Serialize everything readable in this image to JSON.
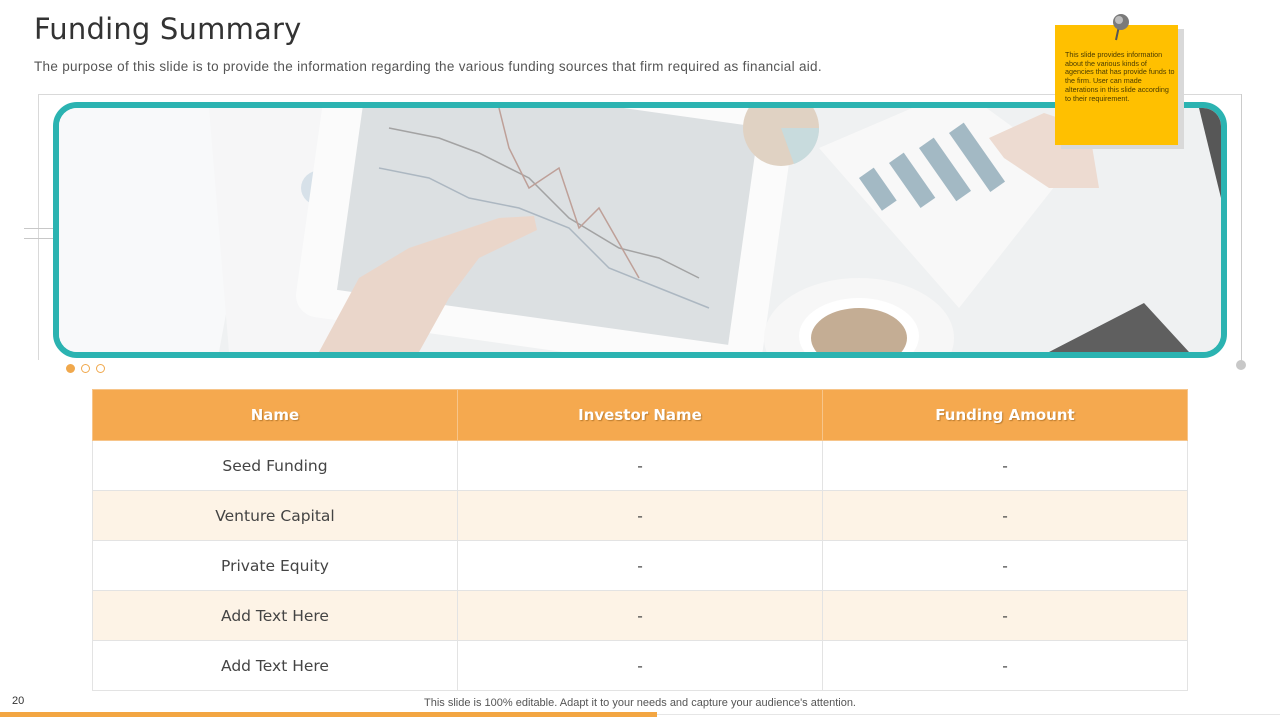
{
  "slide": {
    "title": "Funding Summary",
    "subtitle": "The purpose of this slide is to provide the information regarding the various funding sources that firm required as financial aid."
  },
  "note": {
    "text": "This slide provides information about the various kinds of agencies that has provide funds to the firm. User can made alterations in this slide according to their requirement."
  },
  "carousel": {
    "dots": [
      "filled",
      "empty",
      "empty"
    ]
  },
  "table": {
    "headers": [
      "Name",
      "Investor Name",
      "Funding Amount"
    ],
    "rows": [
      [
        "Seed Funding",
        "-",
        "-"
      ],
      [
        "Venture Capital",
        "-",
        "-"
      ],
      [
        "Private Equity",
        "-",
        "-"
      ],
      [
        "Add Text Here",
        "-",
        "-"
      ],
      [
        "Add Text Here",
        "-",
        "-"
      ]
    ]
  },
  "footer": {
    "page_number": "20",
    "text": "This slide is 100% editable. Adapt it to your needs and capture your audience's attention."
  },
  "colors": {
    "accent_orange": "#f5a94f",
    "frame_teal": "#2bb3b1",
    "note_yellow": "#ffc000",
    "row_alt": "#fdf3e6"
  }
}
